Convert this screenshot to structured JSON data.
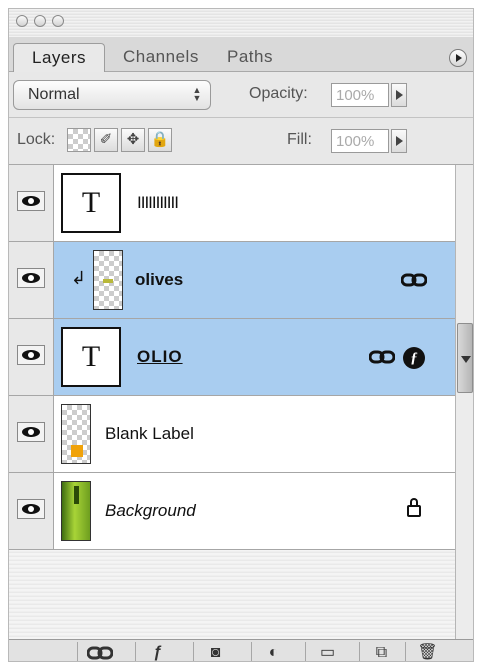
{
  "tabs": [
    {
      "label": "Layers"
    },
    {
      "label": "Channels"
    },
    {
      "label": "Paths"
    }
  ],
  "blend_mode": "Normal",
  "opacity": {
    "label": "Opacity:",
    "value": "100%"
  },
  "lock": {
    "label": "Lock:"
  },
  "fill": {
    "label": "Fill:",
    "value": "100%"
  },
  "layers": [
    {
      "name": "IIIIIIIIIII",
      "kind": "text",
      "selected": false,
      "visible": true
    },
    {
      "name": "olives",
      "kind": "image",
      "selected": true,
      "visible": true,
      "clipped": true,
      "linked": true
    },
    {
      "name": "OLIO",
      "kind": "text",
      "selected": true,
      "visible": true,
      "linked": true,
      "effects": true
    },
    {
      "name": "Blank Label",
      "kind": "image",
      "selected": false,
      "visible": true
    },
    {
      "name": "Background",
      "kind": "image",
      "selected": false,
      "visible": true,
      "locked": true
    }
  ],
  "icons": [
    "eye-icon",
    "link-icon",
    "fx-icon",
    "lock-icon",
    "trash-icon"
  ],
  "colors": {
    "selection": "#a9cdf0",
    "label_orange": "#f0a20a",
    "bottle_green": "#8fc12a"
  }
}
